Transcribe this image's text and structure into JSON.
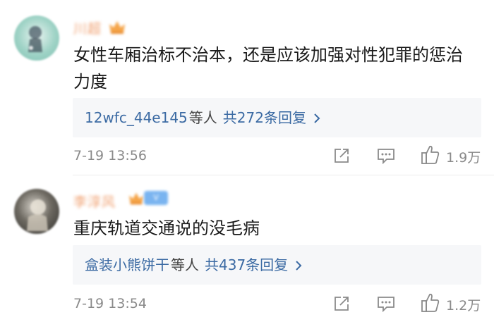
{
  "comments": [
    {
      "username": "川超",
      "text": "女性车厢治标不治本，还是应该加强对性犯罪的惩治力度",
      "replies": {
        "users": "12wfc_44e145",
        "users_suffix": "等人",
        "count_label": "共272条回复"
      },
      "time": "7-19 13:56",
      "likes": "1.9万",
      "badges": [
        "crown-icon"
      ]
    },
    {
      "username": "李淳风",
      "text": "重庆轨道交通说的没毛病",
      "replies": {
        "users": "盒装小熊饼干",
        "users_suffix": "等人",
        "count_label": "共437条回复"
      },
      "time": "7-19 13:54",
      "likes": "1.2万",
      "badges": [
        "crown-icon",
        "vip-badge"
      ]
    }
  ],
  "colors": {
    "username": "#f0a070",
    "link": "#3b6aa3",
    "meta": "#8a8a8a",
    "text": "#1a1a1a",
    "reply_bg": "#f6f7f9"
  }
}
